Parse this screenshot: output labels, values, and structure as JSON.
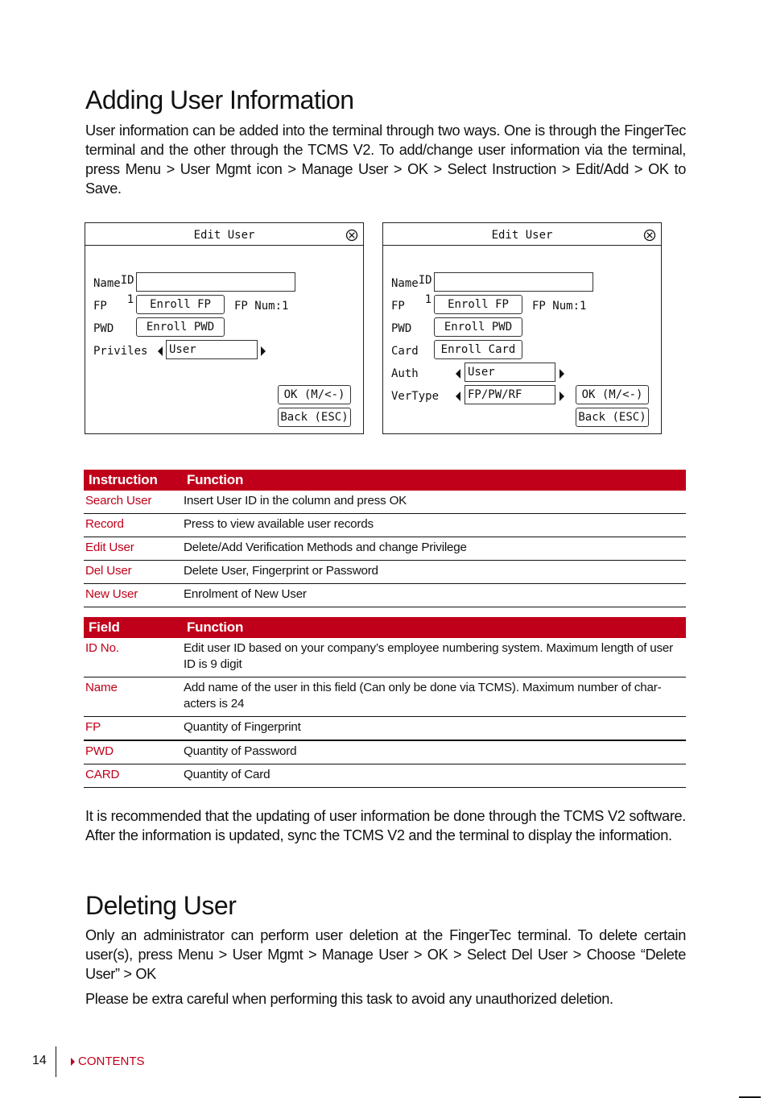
{
  "section1": {
    "title": "Adding User Information",
    "intro": "User information can be added into the terminal through two ways. One is through the FingerTec terminal and the other through the TCMS V2.  To add/change user information via the terminal, press Menu > User Mgmt icon > Manage User > OK > Select Instruction > Edit/Add > OK to Save."
  },
  "screen_left": {
    "title": "Edit User",
    "close_icon": "circled-x-icon",
    "id_label": "ID.NO",
    "id_value": "1",
    "name_label": "Name",
    "name_value": "",
    "fp_label": "FP",
    "enroll_fp": "Enroll FP",
    "fp_num": "FP Num:1",
    "pwd_label": "PWD",
    "enroll_pwd": "Enroll PWD",
    "privilege_label": "Priviles",
    "privilege_value": "User",
    "ok_button": "OK (M/<-)",
    "back_button": "Back (ESC)"
  },
  "screen_right": {
    "title": "Edit User",
    "close_icon": "circled-x-icon",
    "id_label": "ID.NO",
    "id_value": "1",
    "name_label": "Name",
    "name_value": "",
    "fp_label": "FP",
    "enroll_fp": "Enroll FP",
    "fp_num": "FP Num:1",
    "pwd_label": "PWD",
    "enroll_pwd": "Enroll PWD",
    "card_label": "Card",
    "enroll_card": "Enroll Card",
    "auth_label": "Auth",
    "auth_value": "User",
    "vertype_label": "VerType",
    "vertype_value": "FP/PW/RF",
    "ok_button": "OK (M/<-)",
    "back_button": "Back (ESC)"
  },
  "instruction_table": {
    "headers": [
      "Instruction",
      "Function"
    ],
    "rows": [
      {
        "key": "Search User",
        "value": "Insert User ID in the column and press OK"
      },
      {
        "key": "Record",
        "value": "Press to view available user records"
      },
      {
        "key": "Edit User",
        "value": "Delete/Add Verification Methods and change Privilege"
      },
      {
        "key": "Del User",
        "value": "Delete User, Fingerprint or Password"
      },
      {
        "key": "New User",
        "value": "Enrolment of New User"
      }
    ]
  },
  "field_table": {
    "headers": [
      "Field",
      "Function"
    ],
    "rows": [
      {
        "key": "ID No.",
        "value": "Edit user ID based on your company’s employee numbering system. Maximum length of user ID is 9 digit"
      },
      {
        "key": "Name",
        "value": "Add name of the user in this field (Can only be done via TCMS). Maximum number of char-acters is 24"
      },
      {
        "key": "FP",
        "value": "Quantity of Fingerprint"
      },
      {
        "key": "PWD",
        "value": "Quantity of Password"
      },
      {
        "key": "CARD",
        "value": "Quantity of Card"
      }
    ]
  },
  "recommendation": "It is recommended that the updating of user information be done through the TCMS V2 software. After the information is updated, sync the TCMS V2 and the terminal to display the information.",
  "section2": {
    "title": "Deleting User",
    "para1": "Only an administrator can perform user deletion at the FingerTec terminal. To delete certain user(s), press Menu > User Mgmt > Manage User > OK > Select Del User > Choose “Delete User” > OK",
    "para2": "Please be extra careful when performing this task to avoid any unauthorized deletion."
  },
  "footer": {
    "page_number": "14",
    "contents_link": "CONTENTS"
  },
  "colors": {
    "accent": "#c0001a",
    "text": "#111111"
  }
}
